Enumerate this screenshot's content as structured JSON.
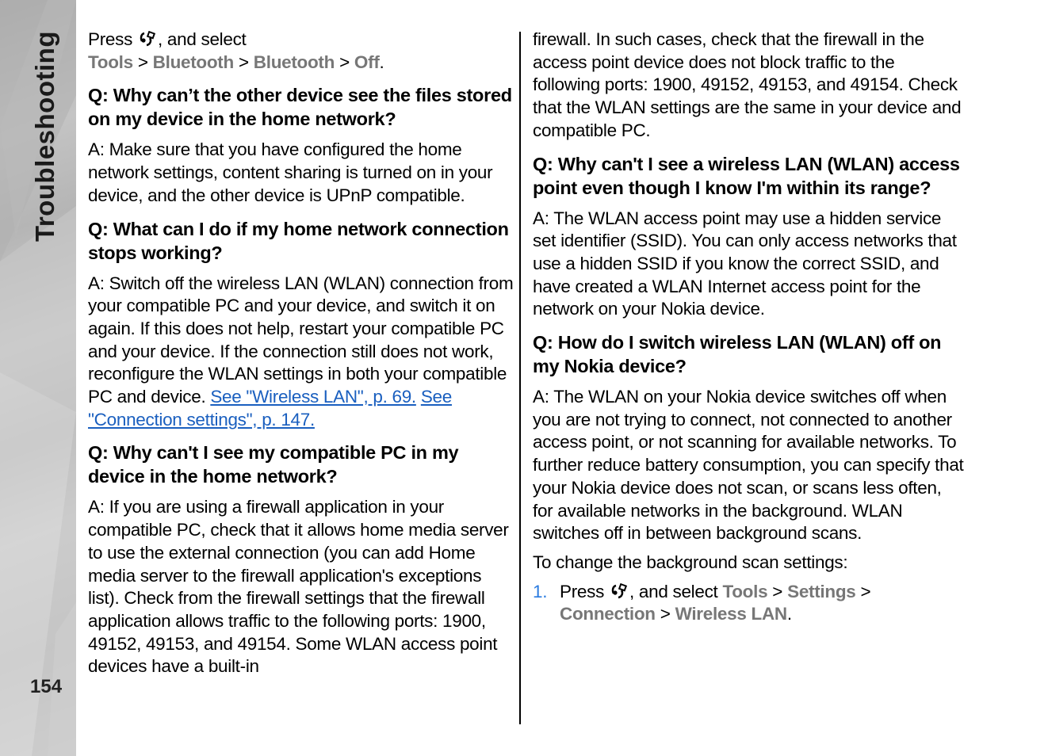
{
  "sidebar": {
    "section_title": "Troubleshooting",
    "page_number": "154"
  },
  "left_column": {
    "intro": {
      "press": "Press",
      "and_select": ", and select",
      "path": [
        "Tools",
        "Bluetooth",
        "Bluetooth",
        "Off"
      ],
      "separator": ">",
      "end": "."
    },
    "qa": [
      {
        "question": "Q: Why can’t the other device see the files stored on my device in the home network?",
        "answer": "A: Make sure that you have configured the home network settings, content sharing is turned on in your device, and the other device is UPnP compatible."
      },
      {
        "question": "Q: What can I do if my home network connection stops working?",
        "answer": "A: Switch off the wireless LAN (WLAN) connection from your compatible PC and your device, and switch it on again. If this does not help, restart your compatible PC and your device. If the connection still does not work, reconfigure the WLAN settings in both your compatible PC and device.",
        "links": [
          "See \"Wireless LAN\", p. 69.",
          "See \"Connection settings\", p. 147."
        ]
      },
      {
        "question": "Q: Why can't I see my compatible PC in my device in the home network?",
        "answer": "A: If you are using a firewall application in your compatible PC, check that it allows home media server to use the external connection (you can add Home media server to the firewall application's exceptions list). Check from the firewall settings that the firewall application allows traffic to the following ports: 1900, 49152, 49153, and 49154. Some WLAN access point devices have a built-in"
      }
    ]
  },
  "right_column": {
    "continued": "firewall. In such cases, check that the firewall in the access point device does not block traffic to the following ports: 1900, 49152, 49153, and 49154. Check that the WLAN settings are the same in your device and compatible PC.",
    "qa": [
      {
        "question": "Q: Why can't I see a wireless LAN (WLAN) access point even though I know I'm within its range?",
        "answer": "A: The WLAN access point may use a hidden service set identifier (SSID). You can only access networks that use a hidden SSID if you know the correct SSID, and have created a WLAN Internet access point for the network on your Nokia device."
      },
      {
        "question": "Q: How do I switch wireless LAN (WLAN) off on my Nokia device?",
        "answer": "A: The WLAN on your Nokia device switches off when you are not trying to connect, not connected to another access point, or not scanning for available networks. To further reduce battery consumption, you can specify that your Nokia device does not scan, or scans less often, for available networks in the background. WLAN switches off in between background scans."
      }
    ],
    "steps_intro": "To change the background scan settings:",
    "steps": [
      {
        "number": "1.",
        "press": "Press",
        "and_select": ", and select",
        "path": [
          "Tools",
          "Settings",
          "Connection",
          "Wireless LAN"
        ],
        "separator": ">",
        "end": "."
      }
    ]
  },
  "icons": {
    "menu_key": "menu-key-icon"
  }
}
